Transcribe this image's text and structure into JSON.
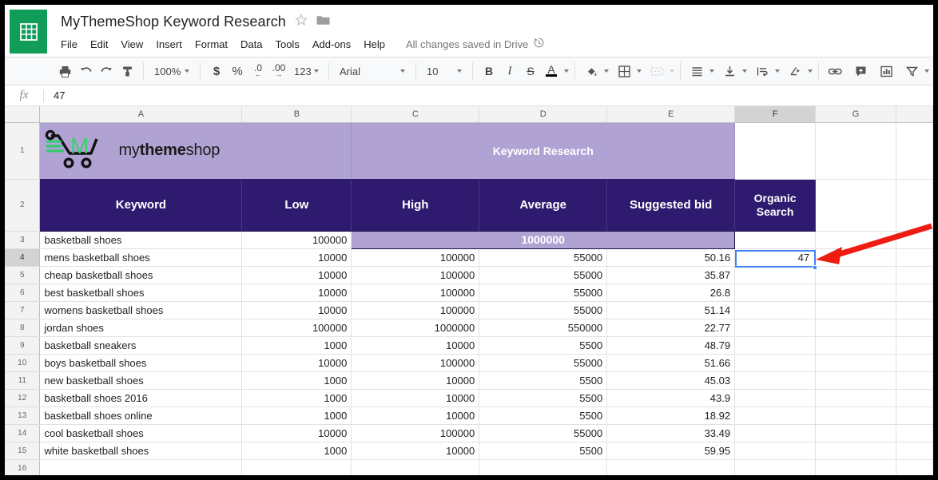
{
  "window": {
    "app_icon": "sheets-icon",
    "doc_title": "MyThemeShop Keyword Research",
    "star_icon": "star-icon",
    "folder_icon": "folder-icon"
  },
  "menus": [
    "File",
    "Edit",
    "View",
    "Insert",
    "Format",
    "Data",
    "Tools",
    "Add-ons",
    "Help"
  ],
  "save_status": {
    "text": "All changes saved in Drive",
    "icon": "history-clock-icon"
  },
  "toolbar": {
    "print": "print-icon",
    "undo": "undo-icon",
    "redo": "redo-icon",
    "paint_format": "paint-format-icon",
    "zoom_value": "100%",
    "currency": "$",
    "percent": "%",
    "decrease_decimal": ".0",
    "increase_decimal": ".00",
    "more_formats": "123",
    "font_value": "Arial",
    "font_size_value": "10",
    "bold": "B",
    "italic": "I",
    "strikethrough": "S",
    "text_color": "A",
    "fill_color": "fill-color-icon",
    "borders": "borders-icon",
    "merge_cells": "merge-cells-icon",
    "horizontal_align": "horizontal-align-icon",
    "vertical_align": "vertical-align-icon",
    "text_wrap": "text-wrap-icon",
    "text_rotation": "text-rotation-icon",
    "insert_link": "link-icon",
    "insert_comment": "comment-icon",
    "insert_chart": "chart-icon",
    "filter": "filter-icon"
  },
  "formula_bar": {
    "fx_label": "fx",
    "value": "47",
    "placeholder": ""
  },
  "grid": {
    "columns": [
      "A",
      "B",
      "C",
      "D",
      "E",
      "F",
      "G",
      ""
    ],
    "selected_column": "F",
    "selected_row": "4",
    "selected_cell_value": "47",
    "rows": [
      "1",
      "2",
      "3",
      "4",
      "5",
      "6",
      "7",
      "8",
      "9",
      "10",
      "11",
      "12",
      "13",
      "14",
      "15",
      "16"
    ],
    "brand_logo_text_light": "my",
    "brand_logo_text_bold": "theme",
    "brand_logo_text_light2": "shop",
    "banner_title": "Keyword Research",
    "headers": [
      "Keyword",
      "Low",
      "High",
      "Average",
      "Suggested bid",
      "Organic Search"
    ],
    "row3_merged_value": "1000000",
    "row3_keyword": "basketball shoes",
    "row3_low": "100000",
    "data": [
      {
        "row": "4",
        "keyword": "mens basketball shoes",
        "low": "10000",
        "high": "100000",
        "average": "55000",
        "bid": "50.16",
        "organic": "47"
      },
      {
        "row": "5",
        "keyword": "cheap basketball shoes",
        "low": "10000",
        "high": "100000",
        "average": "55000",
        "bid": "35.87",
        "organic": ""
      },
      {
        "row": "6",
        "keyword": "best basketball shoes",
        "low": "10000",
        "high": "100000",
        "average": "55000",
        "bid": "26.8",
        "organic": ""
      },
      {
        "row": "7",
        "keyword": "womens basketball shoes",
        "low": "10000",
        "high": "100000",
        "average": "55000",
        "bid": "51.14",
        "organic": ""
      },
      {
        "row": "8",
        "keyword": "jordan shoes",
        "low": "100000",
        "high": "1000000",
        "average": "550000",
        "bid": "22.77",
        "organic": ""
      },
      {
        "row": "9",
        "keyword": "basketball sneakers",
        "low": "1000",
        "high": "10000",
        "average": "5500",
        "bid": "48.79",
        "organic": ""
      },
      {
        "row": "10",
        "keyword": "boys basketball shoes",
        "low": "10000",
        "high": "100000",
        "average": "55000",
        "bid": "51.66",
        "organic": ""
      },
      {
        "row": "11",
        "keyword": "new basketball shoes",
        "low": "1000",
        "high": "10000",
        "average": "5500",
        "bid": "45.03",
        "organic": ""
      },
      {
        "row": "12",
        "keyword": "basketball shoes 2016",
        "low": "1000",
        "high": "10000",
        "average": "5500",
        "bid": "43.9",
        "organic": ""
      },
      {
        "row": "13",
        "keyword": "basketball shoes online",
        "low": "1000",
        "high": "10000",
        "average": "5500",
        "bid": "18.92",
        "organic": ""
      },
      {
        "row": "14",
        "keyword": "cool basketball shoes",
        "low": "10000",
        "high": "100000",
        "average": "55000",
        "bid": "33.49",
        "organic": ""
      },
      {
        "row": "15",
        "keyword": "white basketball shoes",
        "low": "1000",
        "high": "10000",
        "average": "5500",
        "bid": "59.95",
        "organic": ""
      },
      {
        "row": "16",
        "keyword": "",
        "low": "",
        "high": "",
        "average": "",
        "bid": "",
        "organic": ""
      }
    ]
  },
  "annotation": {
    "arrow": "red-arrow-pointing-to-cell-F4"
  },
  "colors": {
    "brand_green": "#0f9d58",
    "header_dark_purple": "#2e1a6e",
    "banner_light_purple": "#b0a3d4",
    "selection_blue": "#4285f4",
    "annotation_red": "#ee1c13"
  }
}
